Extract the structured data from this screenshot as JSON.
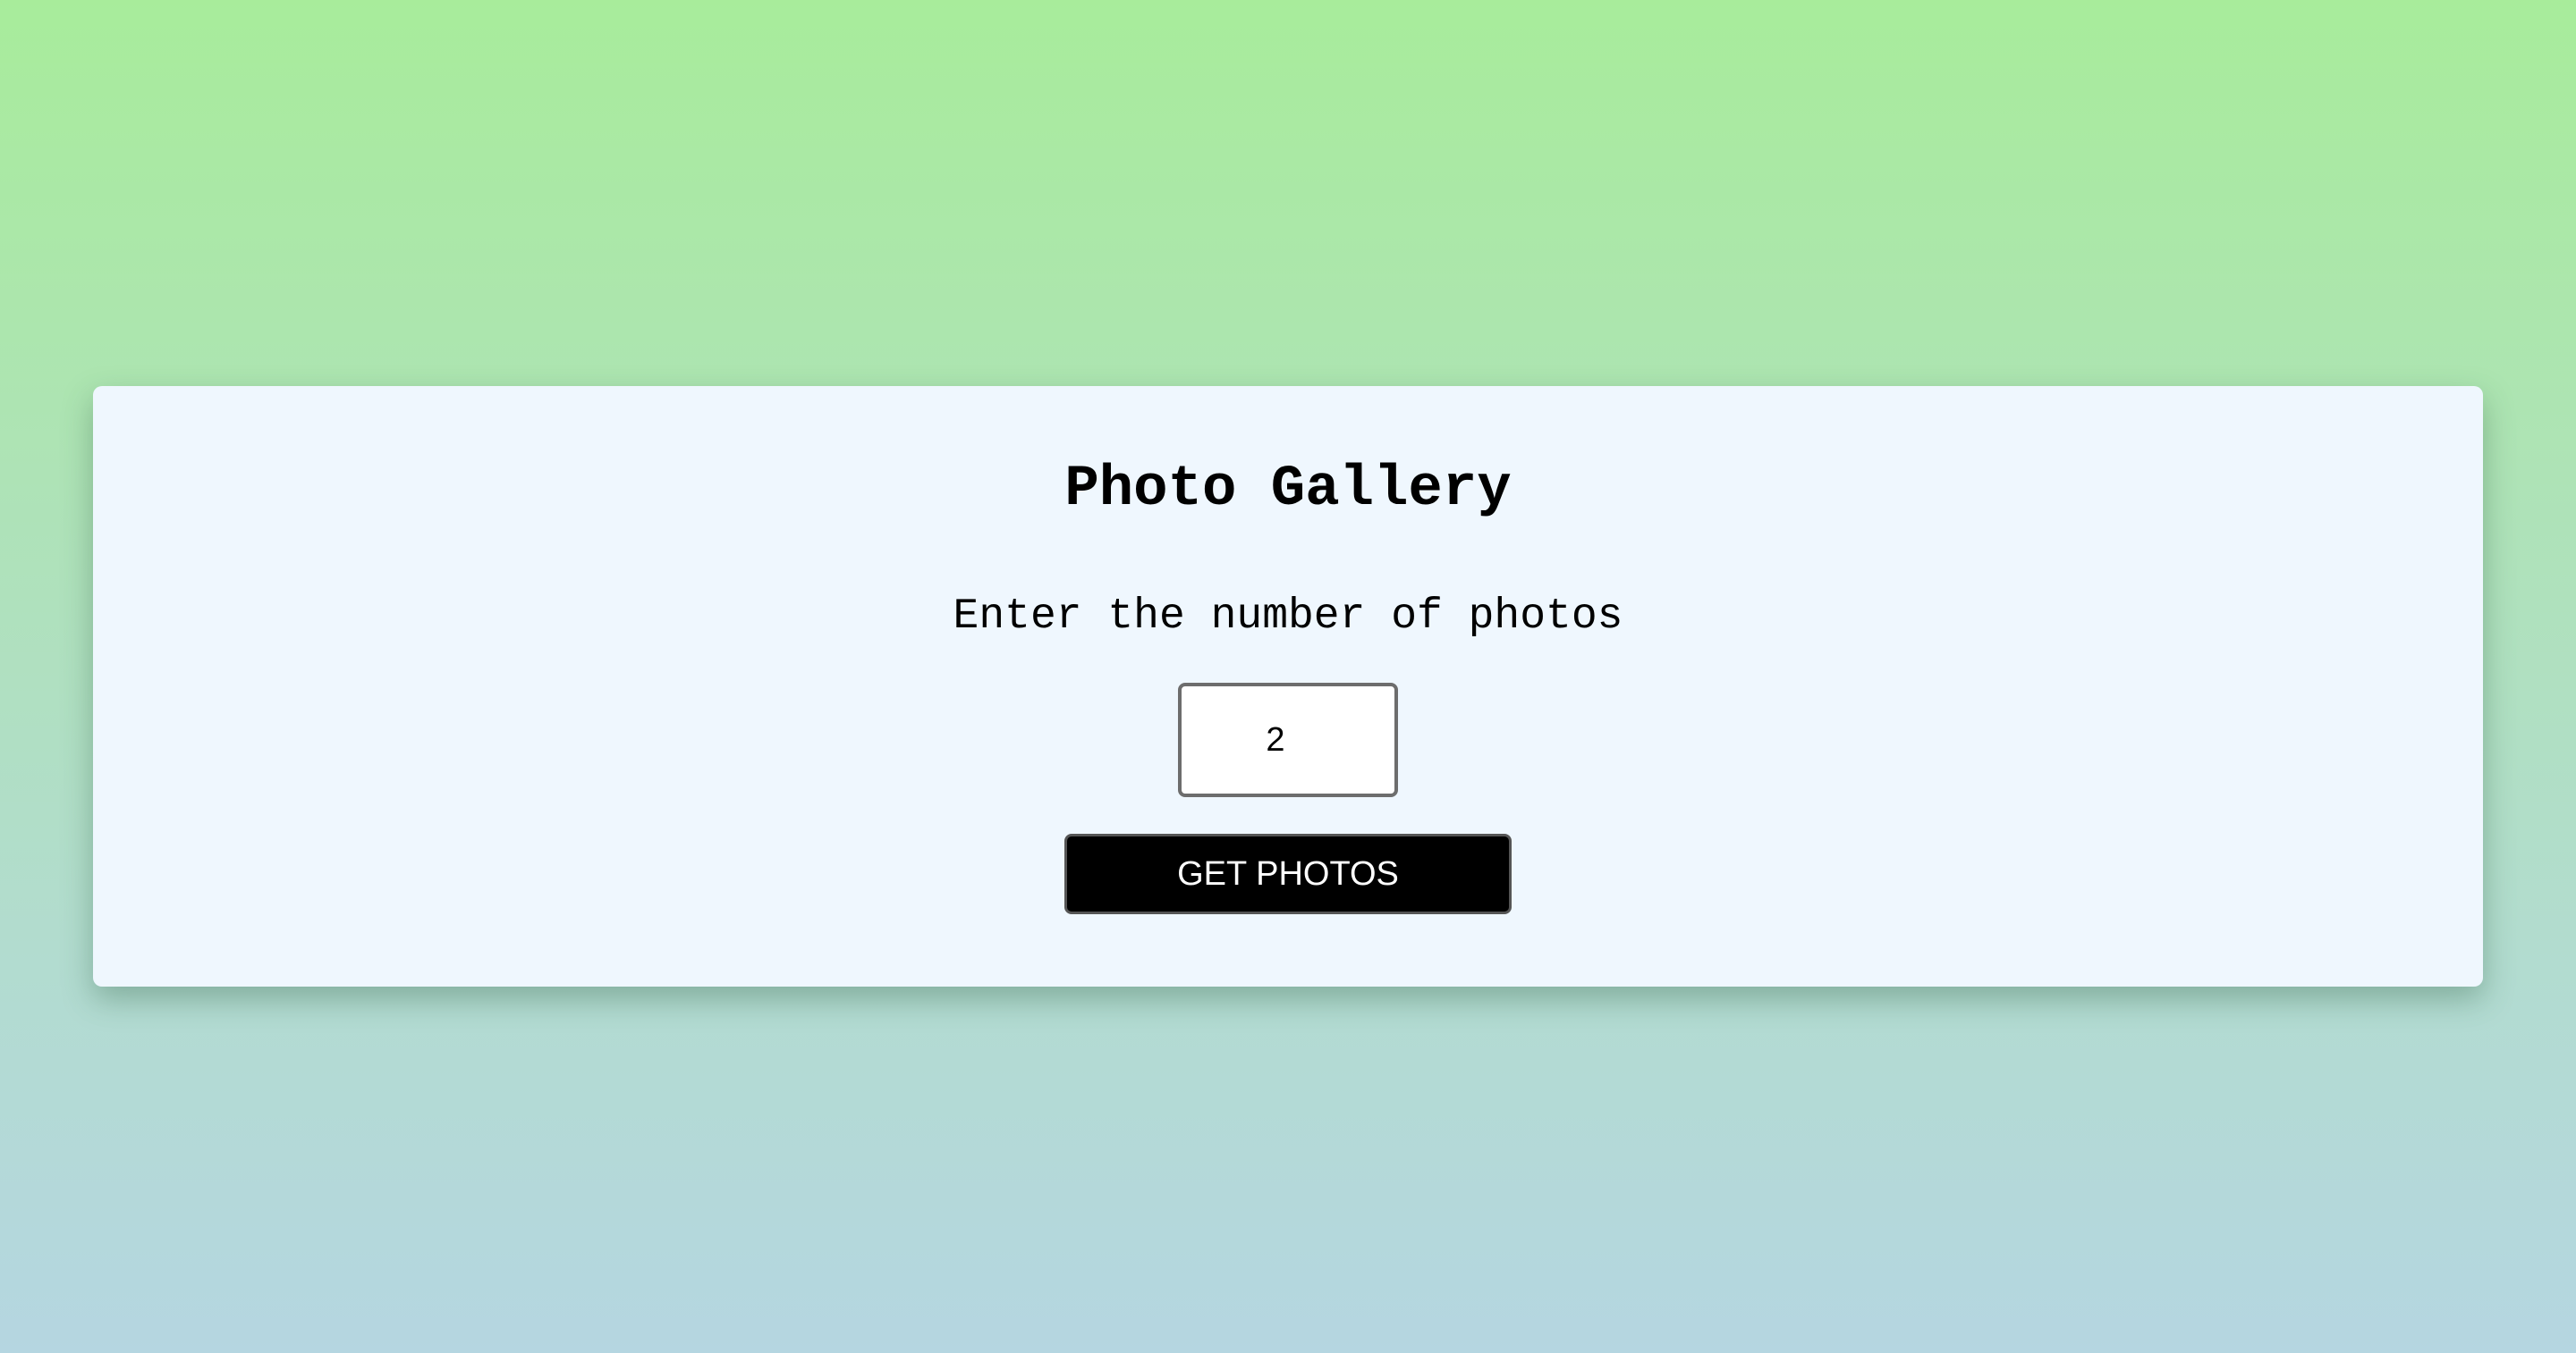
{
  "gallery": {
    "title": "Photo Gallery",
    "prompt": "Enter the number of photos",
    "count_input": {
      "value": "2"
    },
    "submit_label": "GET PHOTOS"
  }
}
